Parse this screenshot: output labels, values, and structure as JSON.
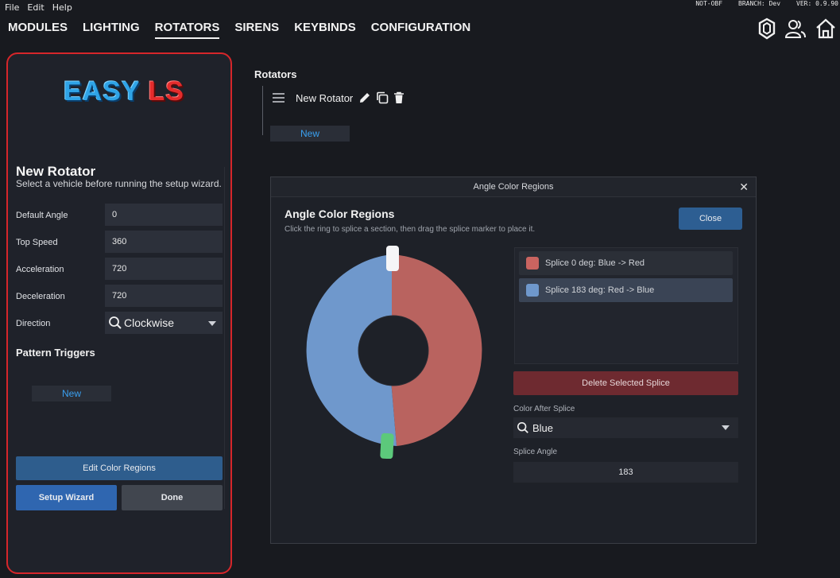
{
  "menubar": {
    "items": [
      "File",
      "Edit",
      "Help"
    ]
  },
  "status": {
    "obf": "NOT-OBF",
    "branch": "BRANCH: Dev",
    "version": "VER: 0.9.90"
  },
  "nav": {
    "tabs": [
      "MODULES",
      "LIGHTING",
      "ROTATORS",
      "SIRENS",
      "KEYBINDS",
      "CONFIGURATION"
    ],
    "active": "ROTATORS"
  },
  "header_icons": [
    "shield-icon",
    "users-icon",
    "home-icon"
  ],
  "logo": {
    "part1": "EASY",
    "part2": "LS"
  },
  "left_panel": {
    "title": "New Rotator",
    "subtitle": "Select a vehicle before running the setup wizard.",
    "fields": [
      {
        "label": "Default Angle",
        "value": "0"
      },
      {
        "label": "Top Speed",
        "value": "360"
      },
      {
        "label": "Acceleration",
        "value": "720"
      },
      {
        "label": "Deceleration",
        "value": "720"
      }
    ],
    "direction": {
      "label": "Direction",
      "value": "Clockwise"
    },
    "pattern_triggers_title": "Pattern Triggers",
    "new_button": "New",
    "edit_regions_button": "Edit Color Regions",
    "setup_wizard_button": "Setup Wizard",
    "done_button": "Done"
  },
  "rotators": {
    "title": "Rotators",
    "items": [
      {
        "name": "New Rotator"
      }
    ],
    "new_button": "New"
  },
  "modal": {
    "window_title": "Angle Color Regions",
    "close_x": "✕",
    "title": "Angle Color Regions",
    "subtitle": "Click the ring to splice a section, then drag the splice marker to place it.",
    "close_button": "Close",
    "ring": {
      "splice_angles": [
        0,
        183
      ],
      "colors": {
        "red": "#b9635f",
        "blue": "#6f98cc"
      }
    },
    "splices": [
      {
        "label": "Splice 0 deg: Blue -> Red",
        "color": "#c96460",
        "selected": false
      },
      {
        "label": "Splice 183 deg: Red -> Blue",
        "color": "#6f98cc",
        "selected": true
      }
    ],
    "delete_button": "Delete Selected Splice",
    "color_after_label": "Color After Splice",
    "color_after_value": "Blue",
    "splice_angle_label": "Splice Angle",
    "splice_angle_value": "183"
  },
  "colors": {
    "accent_blue": "#3aa0f0",
    "panel_border": "#d6262a",
    "danger": "#6e2a30"
  }
}
